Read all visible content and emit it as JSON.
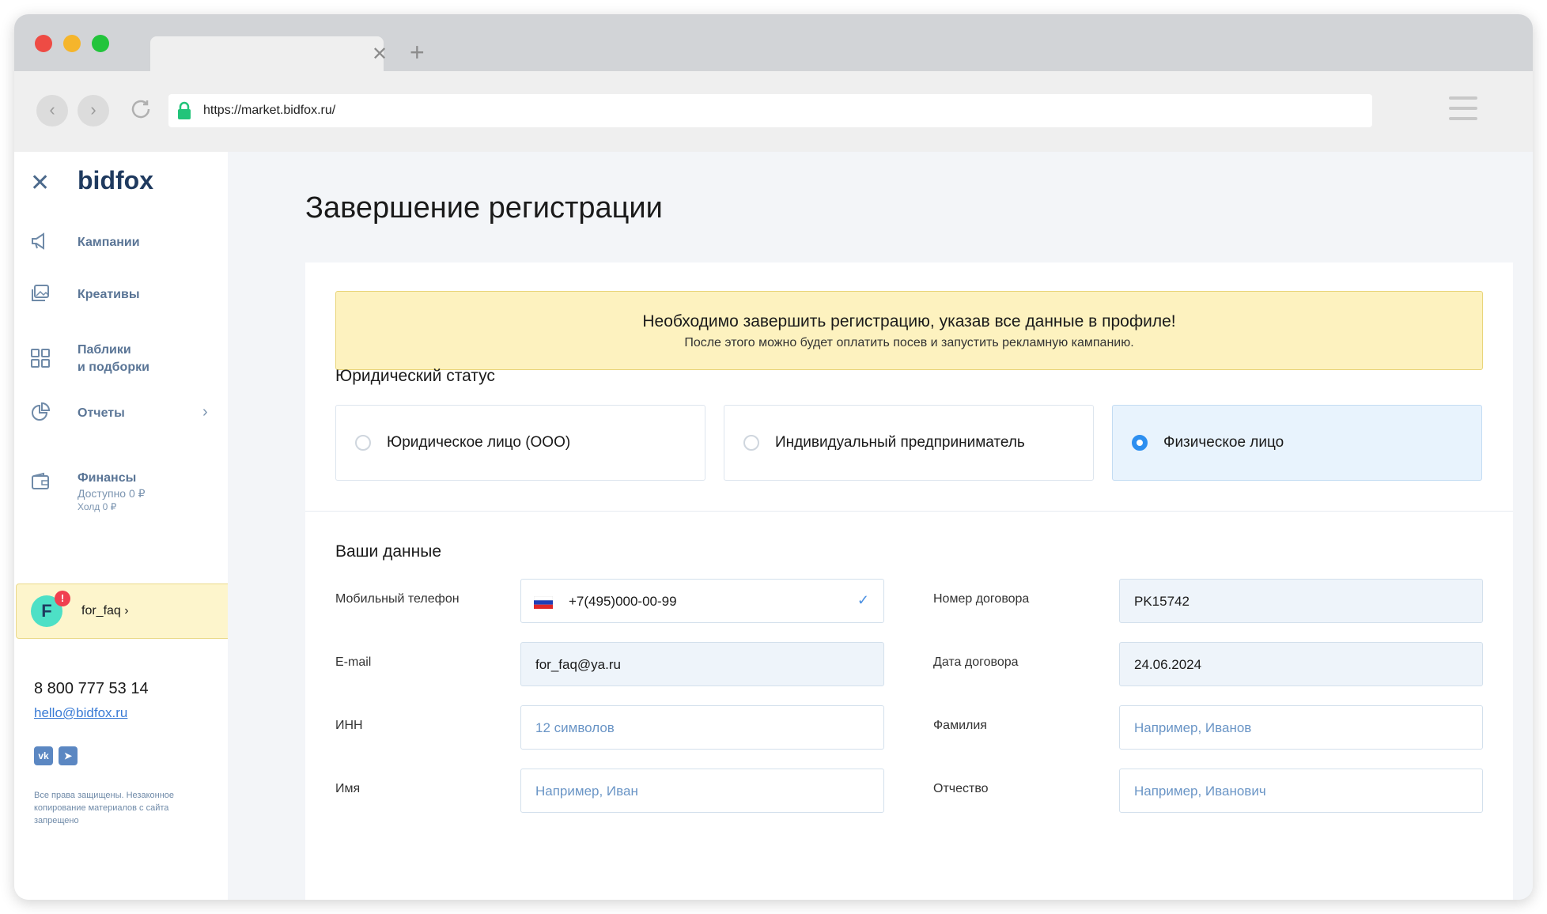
{
  "browser": {
    "url": "https://market.bidfox.ru/",
    "tab_close": "✕",
    "tab_new": "+"
  },
  "sidebar": {
    "logo": "bidfox",
    "close_icon": "✕",
    "nav": [
      {
        "label": "Кампании",
        "icon": "megaphone-icon"
      },
      {
        "label": "Креативы",
        "icon": "images-icon"
      },
      {
        "label": "Паблики",
        "label2": "и подборки",
        "icon": "grid-icon"
      },
      {
        "label": "Отчеты",
        "icon": "pie-chart-icon"
      },
      {
        "label": "Финансы",
        "sub1": "Доступно 0 ₽",
        "sub2": "Холд 0 ₽",
        "icon": "wallet-icon"
      }
    ],
    "user": {
      "initial": "F",
      "badge": "!",
      "name": "for_faq ›"
    },
    "phone": "8 800 777 53 14",
    "email": "hello@bidfox.ru",
    "social": [
      {
        "label": "vk"
      },
      {
        "label": "➤"
      }
    ],
    "copyright": "Все права защищены. Незаконное копирование материалов с сайта запрещено"
  },
  "main": {
    "title": "Завершение регистрации",
    "alert": {
      "title": "Необходимо завершить регистрацию, указав все данные в профиле!",
      "subtitle": "После этого можно будет оплатить посев и запустить рекламную кампанию."
    },
    "legal_status": {
      "title": "Юридический статус",
      "options": [
        {
          "label": "Юридическое лицо (ООО)",
          "selected": false
        },
        {
          "label": "Индивидуальный предприниматель",
          "selected": false
        },
        {
          "label": "Физическое лицо",
          "selected": true
        }
      ]
    },
    "your_data": {
      "title": "Ваши данные",
      "fields": {
        "phone": {
          "label": "Мобильный телефон",
          "value": "+7(495)000-00-99"
        },
        "email": {
          "label": "E-mail",
          "value": "for_faq@ya.ru"
        },
        "inn": {
          "label": "ИНН",
          "placeholder": "12 символов"
        },
        "name": {
          "label": "Имя",
          "placeholder": "Например, Иван"
        },
        "contract_number": {
          "label": "Номер договора",
          "value": "PK15742"
        },
        "contract_date": {
          "label": "Дата договора",
          "value": "24.06.2024"
        },
        "surname": {
          "label": "Фамилия",
          "placeholder": "Например, Иванов"
        },
        "patronymic": {
          "label": "Отчество",
          "placeholder": "Например, Иванович"
        }
      }
    }
  }
}
